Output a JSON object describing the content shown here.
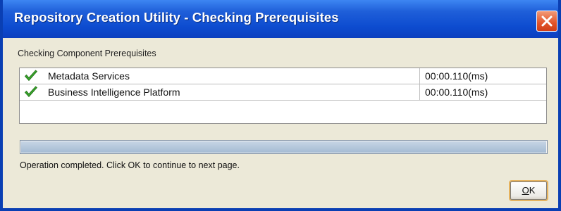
{
  "window": {
    "title": "Repository Creation Utility - Checking Prerequisites",
    "title_bar_color": "#0d4cd0",
    "close_icon": "close-x-icon"
  },
  "content": {
    "heading": "Checking Component Prerequisites",
    "components": [
      {
        "status_icon": "green-check-icon",
        "name": "Metadata Services",
        "time": "00:00.110(ms)"
      },
      {
        "status_icon": "green-check-icon",
        "name": "Business Intelligence Platform",
        "time": "00:00.110(ms)"
      }
    ],
    "progress_fraction": 1.0,
    "status_message": "Operation completed. Click OK to continue to next page."
  },
  "buttons": {
    "ok_mnemonic": "O",
    "ok_rest": "K"
  }
}
